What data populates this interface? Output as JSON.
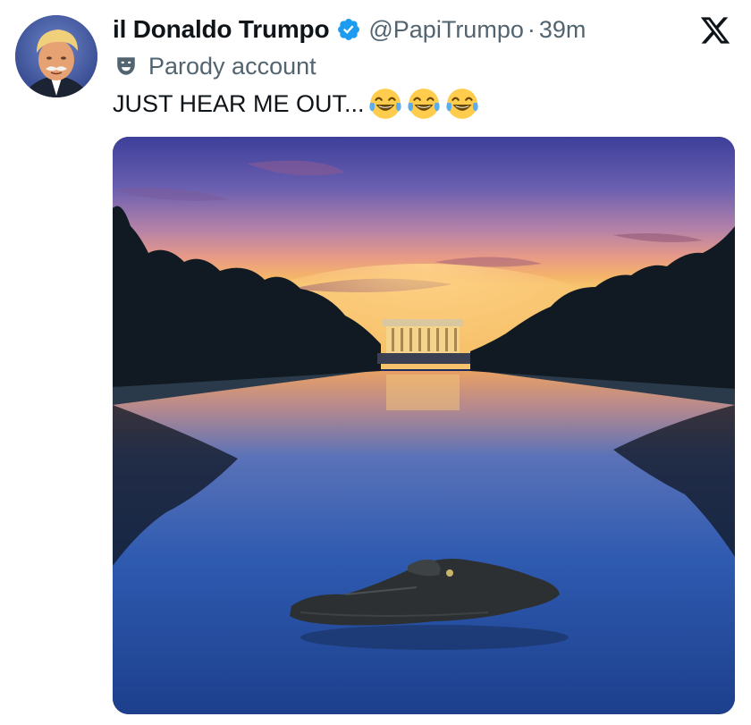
{
  "tweet": {
    "author": {
      "display_name": "il Donaldo Trumpo",
      "handle": "@PapiTrumpo",
      "verified": true,
      "avatar_icon": "avatar-portrait"
    },
    "separator": "·",
    "timestamp": "39m",
    "label": {
      "icon": "theater-mask-icon",
      "text": "Parody account"
    },
    "text": "JUST HEAR ME OUT...",
    "emojis": [
      "face-with-tears-of-joy",
      "face-with-tears-of-joy",
      "face-with-tears-of-joy"
    ],
    "media": {
      "type": "photo",
      "subject": "reflecting pool with memorial at sunset and alligator in water"
    }
  },
  "app": {
    "logo_icon": "x-logo-icon"
  },
  "colors": {
    "text_primary": "#0f1419",
    "text_secondary": "#536471",
    "verified_blue": "#1d9bf0"
  }
}
